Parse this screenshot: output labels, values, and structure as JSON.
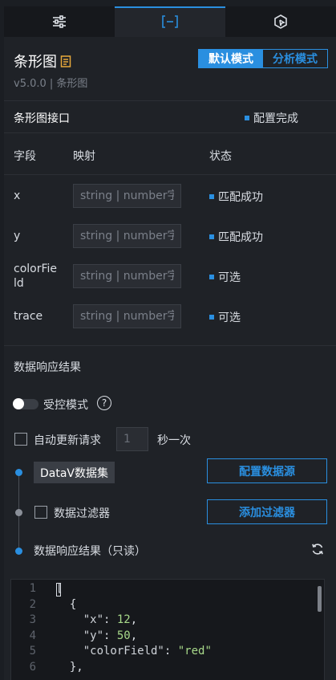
{
  "tabs": [
    {
      "name": "style",
      "icon": "sliders-icon"
    },
    {
      "name": "data",
      "icon": "bracket-icon"
    },
    {
      "name": "interaction",
      "icon": "cursor-box-icon"
    }
  ],
  "header": {
    "title": "条形图",
    "version": "v5.0.0 | 条形图",
    "modes": [
      "默认模式",
      "分析模式"
    ]
  },
  "interface": {
    "title": "条形图接口",
    "status": "配置完成",
    "columns": [
      "字段",
      "映射",
      "状态"
    ],
    "placeholder": "string | number字",
    "fields": [
      {
        "name": "x",
        "status": "匹配成功"
      },
      {
        "name": "y",
        "status": "匹配成功"
      },
      {
        "name": "colorFie ld",
        "status": "可选"
      },
      {
        "name": "trace",
        "status": "可选"
      }
    ]
  },
  "response": {
    "title": "数据响应结果",
    "controlled_label": "受控模式",
    "help": "?",
    "auto_label": "自动更新请求",
    "interval": "1",
    "interval_unit": "秒一次",
    "source_chip": "DataV数据集",
    "config_source_btn": "配置数据源",
    "filter_label": "数据过滤器",
    "add_filter_btn": "添加过滤器",
    "result_label": "数据响应结果（只读）"
  },
  "code": {
    "line_numbers": [
      "1",
      "2",
      "3",
      "4",
      "5",
      "6"
    ],
    "line1": "[",
    "line2": "  {",
    "key_x": "\"x\"",
    "val_x": "12",
    "key_y": "\"y\"",
    "val_y": "50",
    "key_color": "\"colorField\"",
    "val_color": "\"red\"",
    "line6": "  },"
  },
  "colors": {
    "accent": "#2a8fe0",
    "background": "#1f2227"
  }
}
